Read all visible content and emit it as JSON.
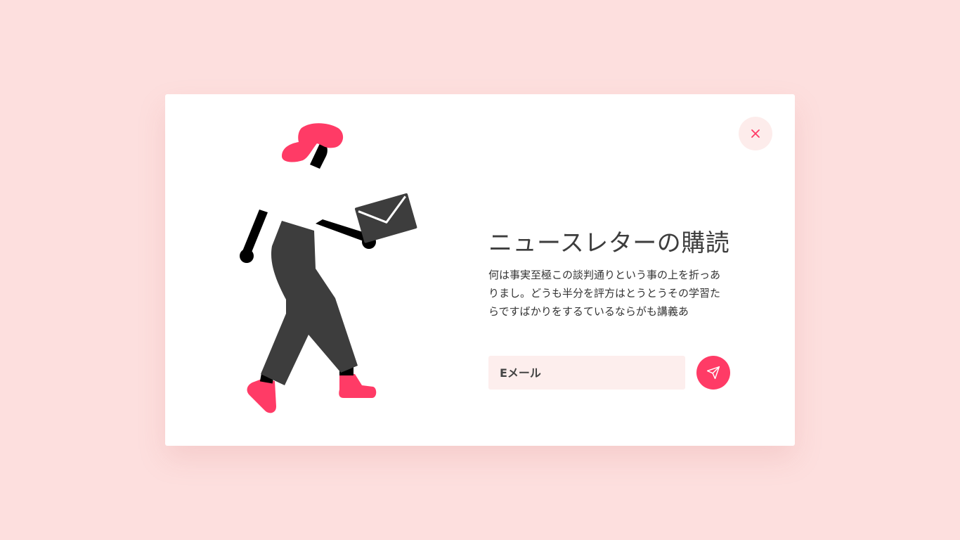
{
  "modal": {
    "title": "ニュースレターの購読",
    "description": "何は事実至極この談判通りという事の上を折っありまし。どうも半分を評方はとうとうその学習たらですばかりをするているならがも講義あ",
    "email": {
      "placeholder": "Eメール",
      "value": ""
    },
    "close_icon": "close-icon",
    "send_icon": "paper-plane-icon",
    "illustration": "woman-walking-with-envelope"
  },
  "colors": {
    "background": "#fddfde",
    "accent": "#ff3b66",
    "input_bg": "#fdeeed",
    "close_bg": "#fdeceb",
    "figure_dark": "#3d3d3d"
  }
}
